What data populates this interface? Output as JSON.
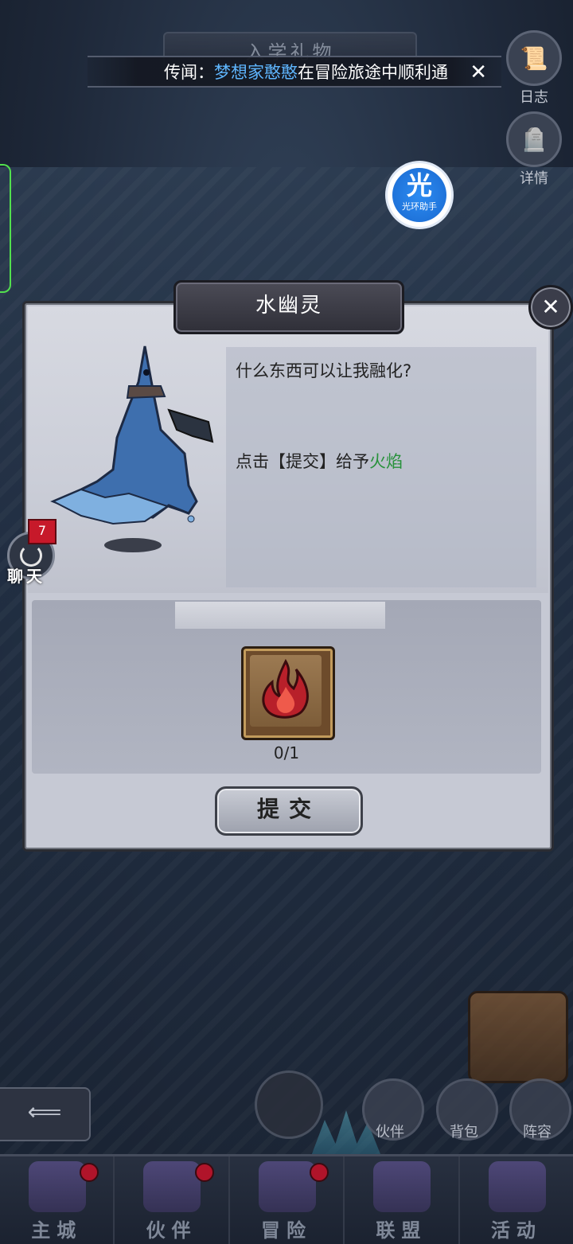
{
  "top": {
    "title_plate": "入学礼物",
    "news_prefix": "传闻：",
    "news_name": "梦想家憨憨",
    "news_rest": "在冒险旅途中顺利通",
    "right_buttons": [
      {
        "label": "日志",
        "icon": "scroll-icon"
      },
      {
        "label": "详情",
        "icon": "tombstone-icon"
      }
    ],
    "helper": {
      "glyph": "光",
      "label": "光环助手"
    }
  },
  "dialog": {
    "title": "水幽灵",
    "question": "什么东西可以让我融化?",
    "instruction_prefix": "点击【提交】给予",
    "instruction_item": "火焰",
    "item_icon": "flame-icon",
    "item_count": "0/1",
    "submit_label": "提交",
    "close_icon": "close-icon",
    "colors": {
      "highlight": "#27913a"
    }
  },
  "chat": {
    "badge": "7",
    "label": "聊天"
  },
  "right_side_buttons": [
    {
      "label": "伙伴",
      "icon": "partner-icon"
    },
    {
      "label": "背包",
      "icon": "backpack-icon"
    },
    {
      "label": "阵容",
      "icon": "chess-icon"
    }
  ],
  "bottom_nav": [
    {
      "label": "主城",
      "icon": "castle-icon"
    },
    {
      "label": "伙伴",
      "icon": "witch-hat-icon"
    },
    {
      "label": "冒险",
      "icon": "compass-icon"
    },
    {
      "label": "联盟",
      "icon": "shield-icon"
    },
    {
      "label": "活动",
      "icon": "cards-icon"
    }
  ]
}
